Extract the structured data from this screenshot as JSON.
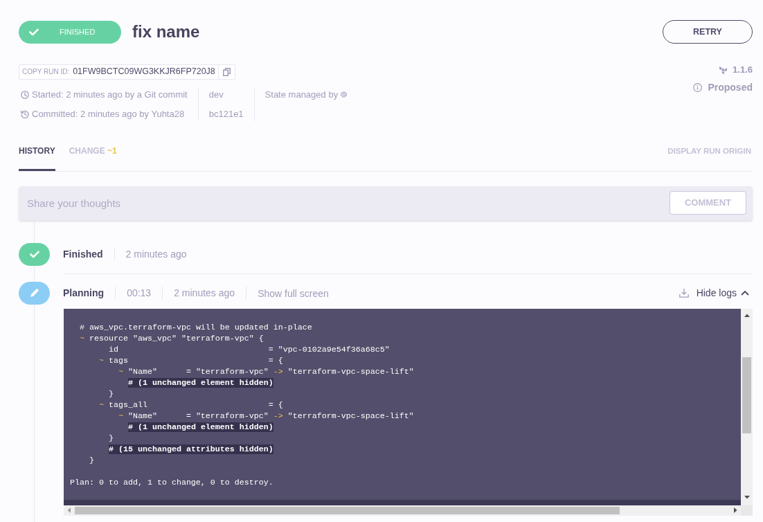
{
  "header": {
    "status": {
      "label": "FINISHED",
      "kind": "finished"
    },
    "title": "fix name",
    "retry_button": "RETRY"
  },
  "run_id": {
    "label": "COPY RUN ID:",
    "value": "01FW9BCTC09WG3KKJR6FP720J8"
  },
  "meta": {
    "started": "Started: 2 minutes ago by a Git commit",
    "committed": "Committed: 2 minutes ago by Yuhta28",
    "branch": "dev",
    "commit": "bc121e1",
    "state_managed": "State managed by"
  },
  "version": "1.1.6",
  "run_type": "Proposed",
  "tabs": [
    {
      "label": "HISTORY",
      "selected": true
    },
    {
      "label": "CHANGE",
      "count": "~1",
      "selected": false
    }
  ],
  "display_origin": "DISPLAY RUN ORIGIN",
  "comment": {
    "placeholder": "Share your thoughts",
    "button": "COMMENT"
  },
  "history": [
    {
      "kind": "finished",
      "label": "Finished",
      "time": "2 minutes ago"
    },
    {
      "kind": "planning",
      "label": "Planning",
      "duration": "00:13",
      "time": "2 minutes ago",
      "fullscreen": "Show full screen",
      "hide_logs": "Hide logs",
      "expanded": true,
      "log": {
        "lines": [
          {
            "segments": [
              {
                "kind": "plain",
                "text": "  # aws_vpc.terraform-vpc will be updated in-place"
              }
            ]
          },
          {
            "segments": [
              {
                "kind": "change",
                "text": "  ~"
              },
              {
                "kind": "plain",
                "text": " resource \"aws_vpc\" \"terraform-vpc\" {"
              }
            ]
          },
          {
            "segments": [
              {
                "kind": "plain",
                "text": "        id                               = \"vpc-0102a9e54f36a68c5\""
              }
            ]
          },
          {
            "segments": [
              {
                "kind": "change",
                "text": "      ~"
              },
              {
                "kind": "plain",
                "text": " tags                             = {"
              }
            ]
          },
          {
            "segments": [
              {
                "kind": "change",
                "text": "          ~"
              },
              {
                "kind": "plain",
                "text": " \"Name\"      = \"terraform-vpc\" "
              },
              {
                "kind": "change",
                "text": "->"
              },
              {
                "kind": "plain",
                "text": " \"terraform-vpc-space-lift\""
              }
            ]
          },
          {
            "segments": [
              {
                "kind": "note",
                "text": "            # (1 unchanged element hidden)"
              }
            ]
          },
          {
            "segments": [
              {
                "kind": "plain",
                "text": "        }"
              }
            ]
          },
          {
            "segments": [
              {
                "kind": "change",
                "text": "      ~"
              },
              {
                "kind": "plain",
                "text": " tags_all                         = {"
              }
            ]
          },
          {
            "segments": [
              {
                "kind": "change",
                "text": "          ~"
              },
              {
                "kind": "plain",
                "text": " \"Name\"      = \"terraform-vpc\" "
              },
              {
                "kind": "change",
                "text": "->"
              },
              {
                "kind": "plain",
                "text": " \"terraform-vpc-space-lift\""
              }
            ]
          },
          {
            "segments": [
              {
                "kind": "note",
                "text": "            # (1 unchanged element hidden)"
              }
            ]
          },
          {
            "segments": [
              {
                "kind": "plain",
                "text": "        }"
              }
            ]
          },
          {
            "segments": [
              {
                "kind": "note",
                "text": "        # (15 unchanged attributes hidden)"
              }
            ]
          },
          {
            "segments": [
              {
                "kind": "plain",
                "text": "    }"
              }
            ]
          }
        ],
        "summary": "Plan: 0 to add, 1 to change, 0 to destroy."
      }
    }
  ]
}
